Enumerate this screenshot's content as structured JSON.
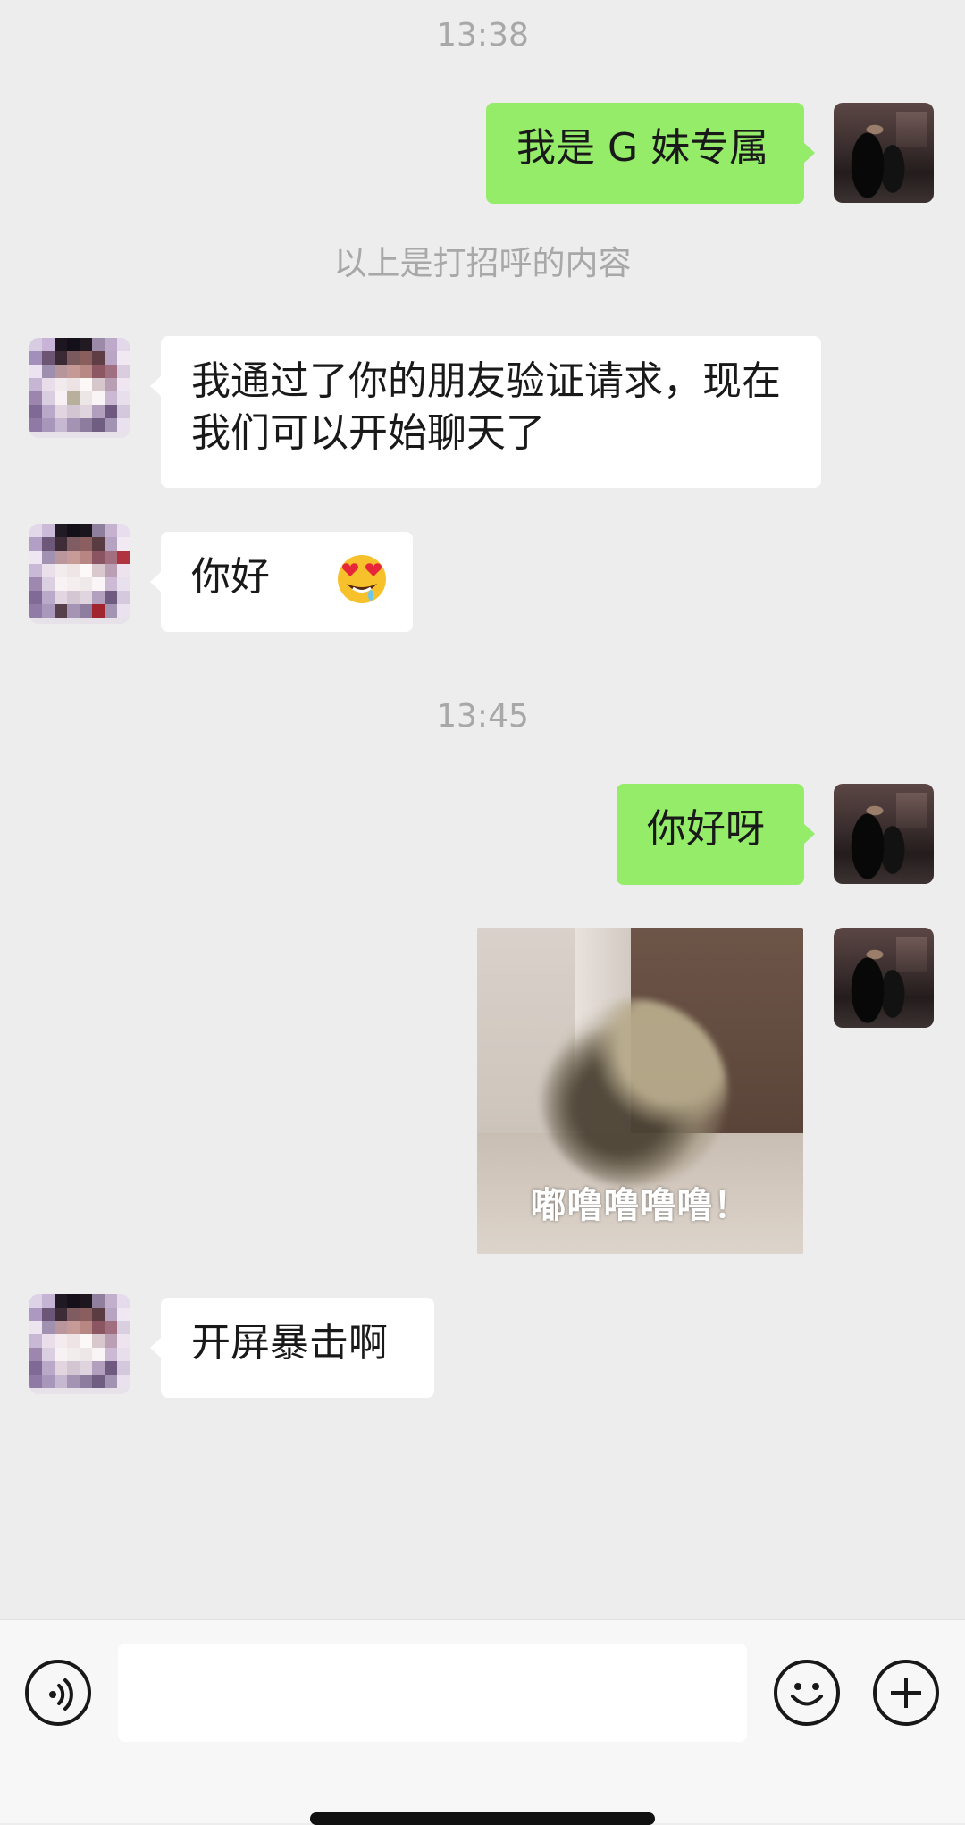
{
  "chat": {
    "timestamps": [
      "13:38",
      "13:45"
    ],
    "system_note": "以上是打招呼的内容",
    "messages": [
      {
        "sender": "self",
        "type": "text",
        "text": "我是 G 妹专属"
      },
      {
        "sender": "friend",
        "type": "text",
        "text": "我通过了你的朋友验证请求，现在我们可以开始聊天了"
      },
      {
        "sender": "friend",
        "type": "text",
        "text": "你好",
        "emoji": "heart-eyes-drooling-emoji"
      },
      {
        "sender": "self",
        "type": "text",
        "text": "你好呀"
      },
      {
        "sender": "self",
        "type": "sticker",
        "caption": "嘟噜噜噜噜！",
        "image": "fluffy-cat-spinning-sticker"
      },
      {
        "sender": "friend",
        "type": "text",
        "text": "开屏暴击啊"
      }
    ]
  },
  "input_bar": {
    "voice_icon": "voice-input-icon",
    "emoji_icon": "smiley-icon",
    "more_icon": "plus-circle-icon"
  },
  "colors": {
    "background": "#ededed",
    "self_bubble": "#95ec69",
    "friend_bubble": "#ffffff",
    "meta_text": "#a8a8a8"
  }
}
